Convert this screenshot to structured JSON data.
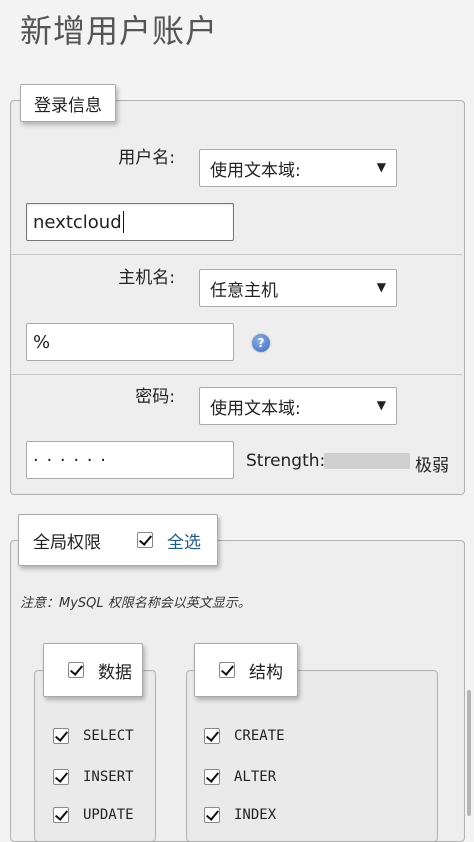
{
  "page": {
    "title": "新增用户账户"
  },
  "login_info": {
    "legend": "登录信息",
    "username": {
      "label": "用户名:",
      "select": "使用文本域:",
      "value": "nextcloud"
    },
    "hostname": {
      "label": "主机名:",
      "select": "任意主机",
      "value": "%"
    },
    "password": {
      "label": "密码:",
      "select": "使用文本域:",
      "value": "· · · · · ·",
      "strength_label": "Strength:",
      "strength_value": "极弱"
    }
  },
  "global_privileges": {
    "legend": "全局权限",
    "select_all": "全选",
    "note": "注意：MySQL 权限名称会以英文显示。",
    "groups": [
      {
        "label": "数据",
        "items": [
          "SELECT",
          "INSERT",
          "UPDATE"
        ]
      },
      {
        "label": "结构",
        "items": [
          "CREATE",
          "ALTER",
          "INDEX"
        ]
      }
    ]
  },
  "icons": {
    "dropdown": "caret-down-icon",
    "help": "help-icon",
    "checkbox": "checkmark-icon"
  }
}
